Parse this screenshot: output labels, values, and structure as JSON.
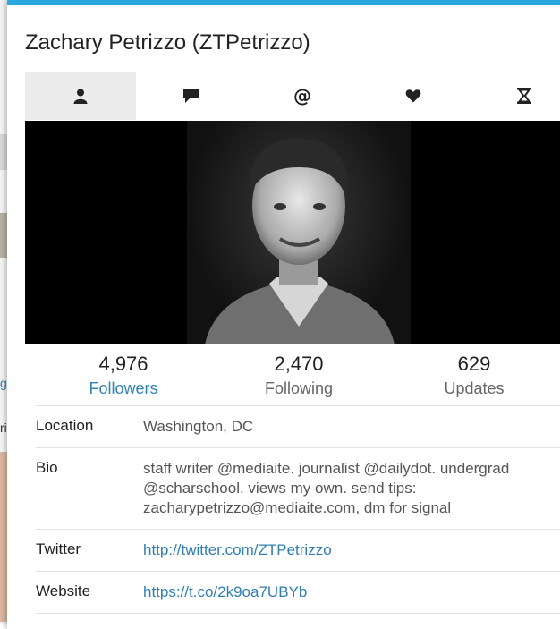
{
  "background": {
    "snippets": [
      "g",
      "ri"
    ]
  },
  "profile": {
    "title": "Zachary Petrizzo (ZTPetrizzo)",
    "tabs": [
      {
        "icon": "user-icon",
        "active": true
      },
      {
        "icon": "speech-bubble-icon",
        "active": false
      },
      {
        "icon": "at-sign-icon",
        "label": "@",
        "active": false
      },
      {
        "icon": "heart-icon",
        "active": false
      },
      {
        "icon": "hourglass-icon",
        "active": false
      }
    ],
    "stats": {
      "followers": {
        "value": "4,976",
        "label": "Followers"
      },
      "following": {
        "value": "2,470",
        "label": "Following"
      },
      "updates": {
        "value": "629",
        "label": "Updates"
      }
    },
    "details": {
      "location": {
        "label": "Location",
        "value": "Washington, DC"
      },
      "bio": {
        "label": "Bio",
        "value": "staff writer @mediaite. journalist @dailydot. undergrad @scharschool. views my own. send tips: zacharypetrizzo@mediaite.com, dm for signal"
      },
      "twitter": {
        "label": "Twitter",
        "value": "http://twitter.com/ZTPetrizzo"
      },
      "website": {
        "label": "Website",
        "value": "https://t.co/2k9oa7UBYb"
      }
    }
  }
}
